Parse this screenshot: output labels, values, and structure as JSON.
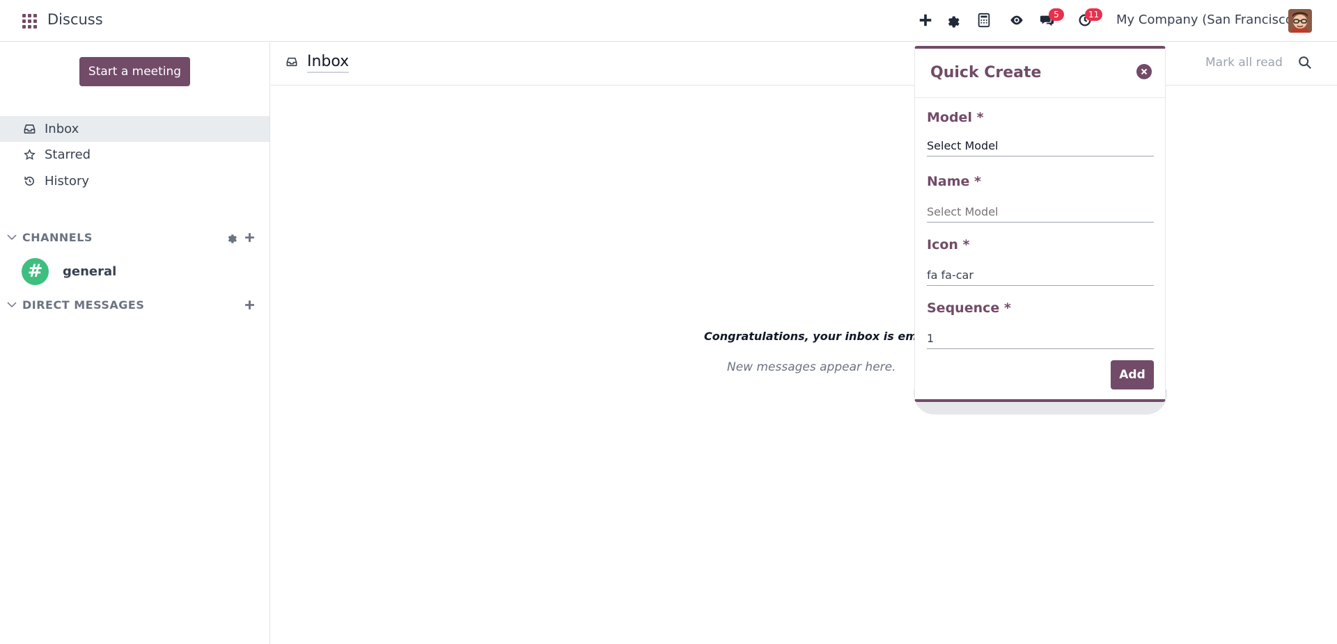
{
  "navbar": {
    "app_title": "Discuss",
    "messages_badge": "5",
    "activities_badge": "11",
    "company": "My Company (San Francisco)"
  },
  "sidebar": {
    "start_meeting": "Start a meeting",
    "items": [
      {
        "label": "Inbox",
        "icon": "inbox-icon"
      },
      {
        "label": "Starred",
        "icon": "star-icon"
      },
      {
        "label": "History",
        "icon": "history-icon"
      }
    ],
    "channels_heading": "CHANNELS",
    "channels": [
      {
        "name": "general",
        "avatar_glyph": "#"
      }
    ],
    "direct_messages_heading": "DIRECT MESSAGES"
  },
  "main": {
    "title": "Inbox",
    "mark_all_read": "Mark all read",
    "empty_title": "Congratulations, your inbox is empty",
    "empty_sub": "New messages appear here."
  },
  "quick_create": {
    "title": "Quick Create",
    "model_label": "Model *",
    "model_value": "Select Model",
    "name_label": "Name *",
    "name_placeholder": "Select Model",
    "icon_label": "Icon *",
    "icon_value": "fa fa-car",
    "sequence_label": "Sequence *",
    "sequence_value": "1",
    "add_label": "Add"
  },
  "colors": {
    "brand": "#714b67",
    "badge": "#e8304d",
    "channel_avatar": "#3fbf7f"
  }
}
